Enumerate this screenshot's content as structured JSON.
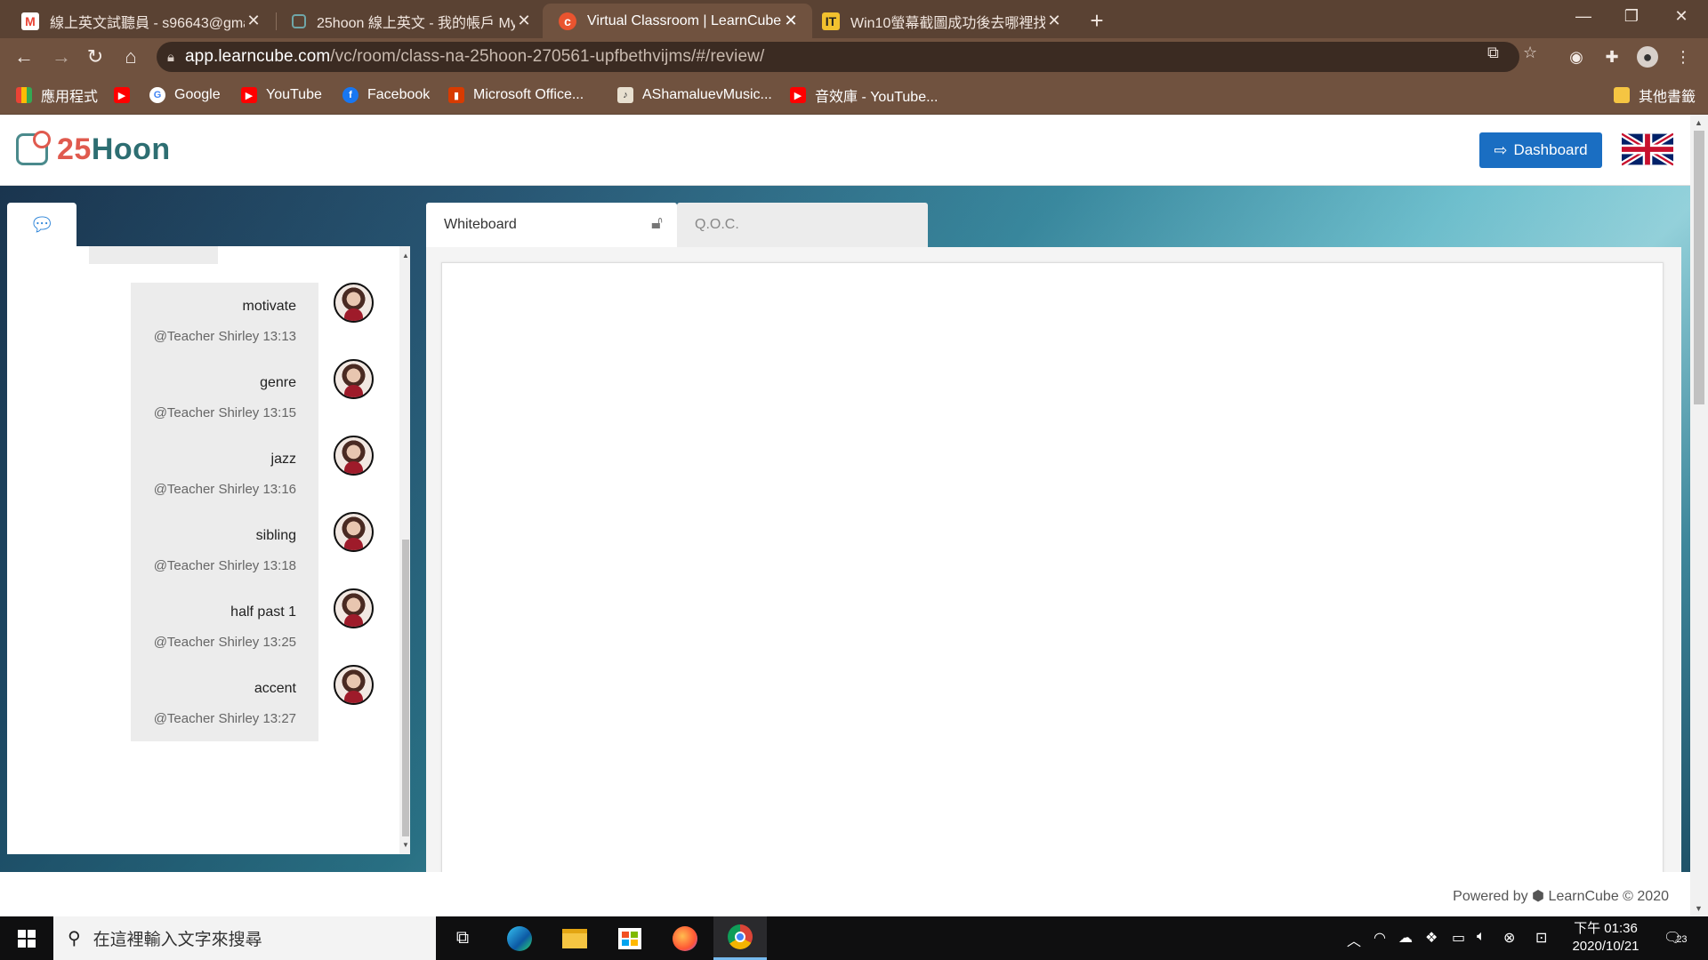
{
  "browser": {
    "tabs": [
      {
        "title": "線上英文試聽員 - s96643@gma",
        "favicon": "gmail-icon",
        "active": false
      },
      {
        "title": "25hoon 線上英文 - 我的帳戶 My",
        "favicon": "25hoon-icon",
        "active": false
      },
      {
        "title": "Virtual Classroom | LearnCube",
        "favicon": "learncube-icon",
        "active": true
      },
      {
        "title": "Win10螢幕截圖成功後去哪裡找",
        "favicon": "it-icon",
        "active": false
      }
    ],
    "url_host": "app.learncube.com",
    "url_path": "/vc/room/class-na-25hoon-270561-upfbethvijms/#/review/",
    "bookmarks": [
      {
        "label": "應用程式",
        "icon": "apps-grid-icon"
      },
      {
        "label": "",
        "icon": "youtube-icon"
      },
      {
        "label": "Google",
        "icon": "google-icon"
      },
      {
        "label": "YouTube",
        "icon": "youtube-icon"
      },
      {
        "label": "Facebook",
        "icon": "facebook-icon"
      },
      {
        "label": "Microsoft Office...",
        "icon": "office-icon"
      },
      {
        "label": "AShamaluevMusic...",
        "icon": "music-icon"
      },
      {
        "label": "音效庫 - YouTube...",
        "icon": "youtube-icon"
      }
    ],
    "other_bookmarks": "其他書籤"
  },
  "header": {
    "logo_number": "25",
    "logo_word": "Hoon",
    "dashboard_label": "Dashboard"
  },
  "chat": {
    "messages": [
      {
        "word": "motivate",
        "meta": "@Teacher Shirley 13:13"
      },
      {
        "word": "genre",
        "meta": "@Teacher Shirley 13:15"
      },
      {
        "word": "jazz",
        "meta": "@Teacher Shirley 13:16"
      },
      {
        "word": "sibling",
        "meta": "@Teacher Shirley 13:18"
      },
      {
        "word": "half past 1",
        "meta": "@Teacher Shirley 13:25"
      },
      {
        "word": "accent",
        "meta": "@Teacher Shirley 13:27"
      }
    ]
  },
  "tabs": {
    "whiteboard": "Whiteboard",
    "qoc": "Q.O.C."
  },
  "footer": {
    "powered_prefix": "Powered by",
    "brand": "LearnCube",
    "copyright": "© 2020"
  },
  "taskbar": {
    "search_placeholder": "在這裡輸入文字來搜尋",
    "time_period": "下午 01:36",
    "date": "2020/10/21",
    "notification_count": "23"
  },
  "colors": {
    "browser_frame": "#5a4233",
    "browser_toolbar": "#70523f",
    "dashboard_button": "#1a6ec2",
    "chat_icon": "#2b83d8"
  }
}
